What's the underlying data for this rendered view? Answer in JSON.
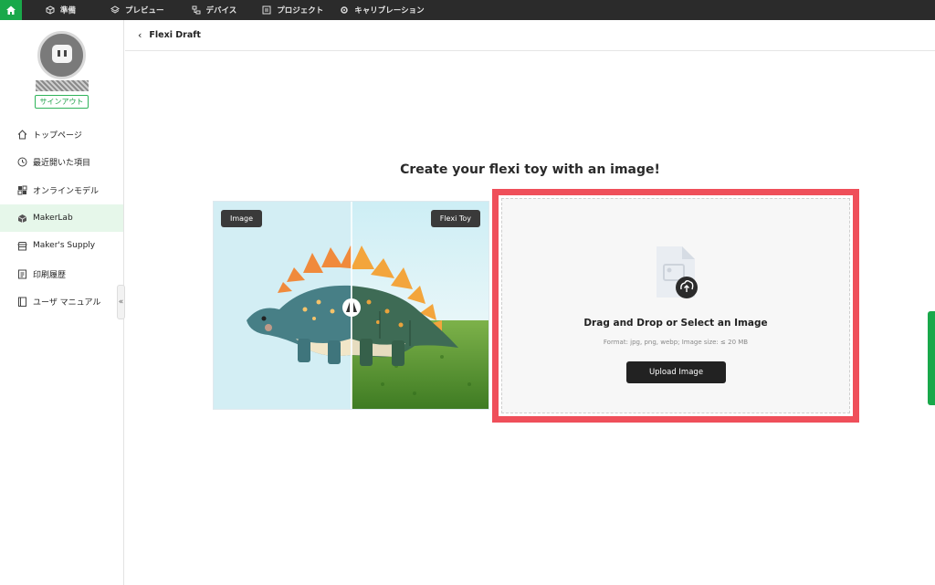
{
  "topbar": {
    "items": [
      {
        "label": "準備",
        "icon": "cube-icon"
      },
      {
        "label": "プレビュー",
        "icon": "layers-icon"
      },
      {
        "label": "デバイス",
        "icon": "devices-icon"
      },
      {
        "label": "プロジェクト",
        "icon": "project-icon"
      },
      {
        "label": "キャリブレーション",
        "icon": "calibration-icon"
      }
    ],
    "home_icon": "home-icon",
    "accent": "#19a84a"
  },
  "sidebar": {
    "signout": "サインアウト",
    "items": [
      {
        "label": "トップページ",
        "icon": "home-outline-icon"
      },
      {
        "label": "最近開いた項目",
        "icon": "clock-icon"
      },
      {
        "label": "オンラインモデル",
        "icon": "models-icon"
      },
      {
        "label": "MakerLab",
        "icon": "makerlab-icon"
      },
      {
        "label": "Maker's Supply",
        "icon": "supply-icon"
      },
      {
        "label": "印刷履歴",
        "icon": "history-icon"
      },
      {
        "label": "ユーザ マニュアル",
        "icon": "manual-icon"
      }
    ],
    "active_index": 3,
    "collapse": "«"
  },
  "header": {
    "back": "‹",
    "title": "Flexi Draft"
  },
  "main": {
    "heading": "Create your flexi toy with an image!",
    "compare": {
      "left_tag": "Image",
      "right_tag": "Flexi Toy"
    },
    "upload": {
      "title": "Drag and Drop or Select an Image",
      "subtitle": "Format: jpg, png, webp; Image size: ≤ 20 MB",
      "button": "Upload Image",
      "highlight_color": "#ef4f5a"
    }
  }
}
